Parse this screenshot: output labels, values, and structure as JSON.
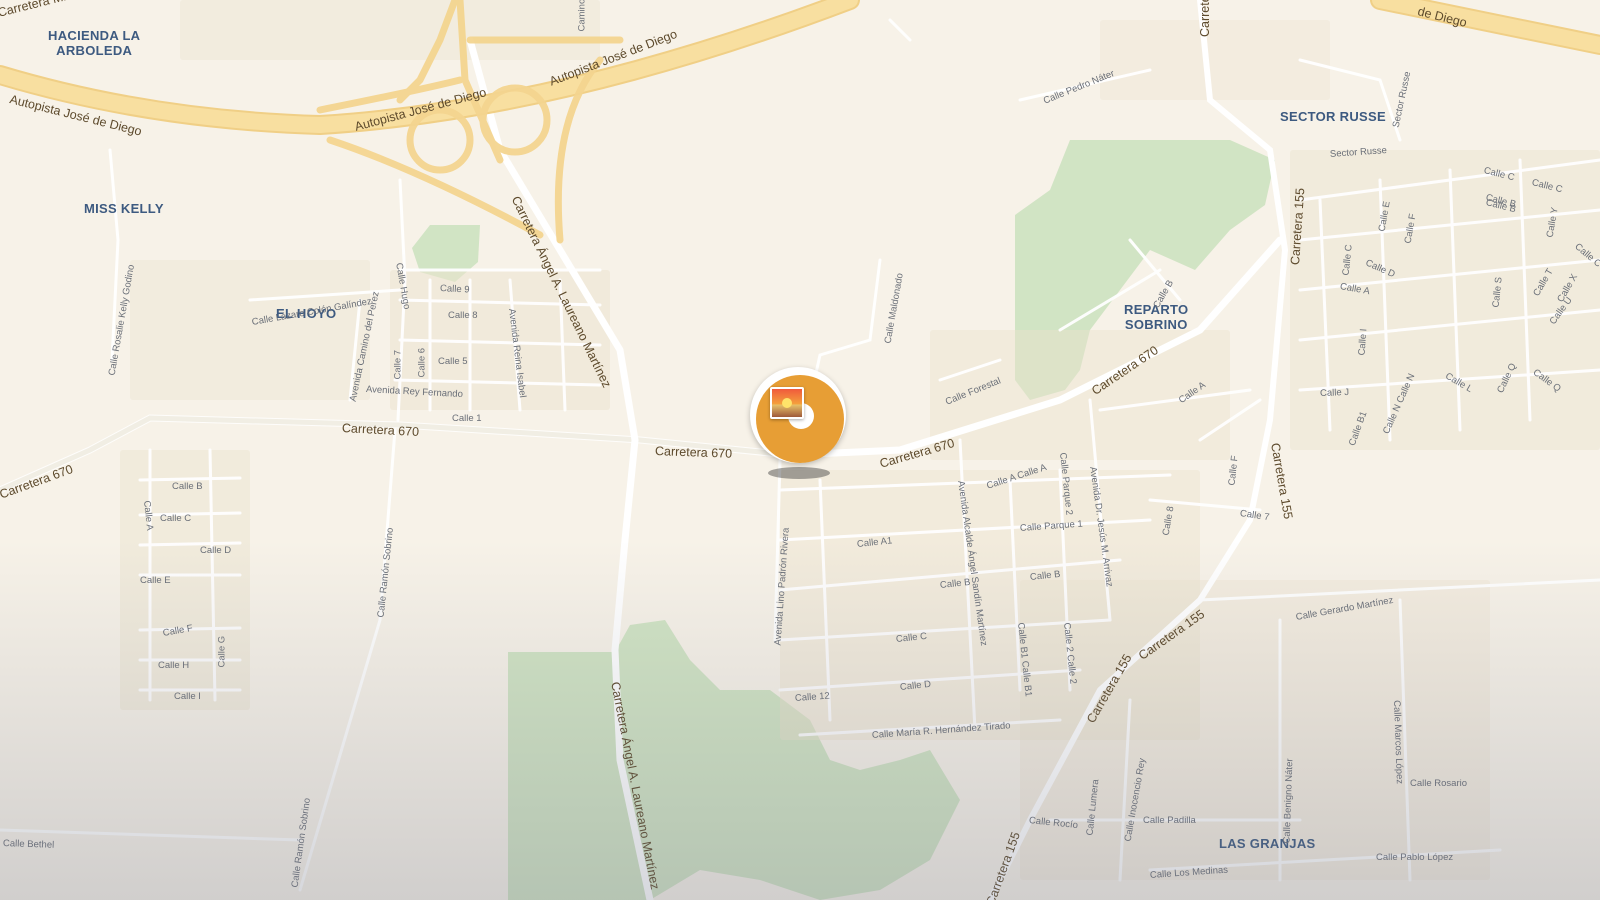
{
  "map": {
    "colors": {
      "background": "#f7f2e8",
      "highway": "#f8dfa0",
      "highway_casing": "#f0cf86",
      "main_road": "#ffffff",
      "street": "#ffffff",
      "park": "#cfe3c2",
      "building": "#efe7d6",
      "area_label": "#3d5a80"
    },
    "areas": {
      "hacienda": "HACIENDA LA\nARBOLEDA",
      "miss_kelly": "MISS KELLY",
      "el_hoyo": "EL HOYO",
      "sector_russe": "SECTOR RUSSE",
      "reparto_sobrino": "REPARTO\nSOBRINO",
      "las_granjas": "LAS GRANJAS"
    },
    "roads": {
      "carretera_militar": "Carretera Militar",
      "autopista_a": "Autopista José de Diego",
      "autopista_b": "Autopista José de Diego",
      "autopista_c": "Autopista José de Diego",
      "de_diego_end": "de Diego",
      "laureano_north": "Carretera Ángel A. Laureano Martínez",
      "laureano_south": "Carretera Ángel A. Laureano Martínez",
      "c670_west": "Carretera 670",
      "c670_mid": "Carretera 670",
      "c670_center": "Carretera 670",
      "c670_east": "Carretera 670",
      "c670_ne": "Carretera 670",
      "c155_north": "Carretera 155",
      "c155_mid": "Carretera 155",
      "c155_se1": "Carretera 155",
      "c155_se2": "Carretera 155",
      "c155_south": "Carretera 155",
      "carr_top": "Carretera"
    },
    "streets": {
      "camino": "Camino",
      "pedro_nater": "Calle Pedro Náter",
      "sector_russe": "Sector Russe",
      "sector_vert": "Sector Russe",
      "rosalie": "Calle Rosalie Kelly Godino",
      "lazaro": "Calle Lázaro Colón Galíndez",
      "calle_9": "Calle 9",
      "calle_8": "Calle 8",
      "calle_5": "Calle 5",
      "calle_7": "Calle 7",
      "calle_6": "Calle 6",
      "calle_1": "Calle 1",
      "hugo": "Calle Hugo",
      "camino_perez": "Avenida Camino del Perez",
      "rey_fernando": "Avenida Rey Fernando",
      "reina_isabel": "Avenida Reina Isabel",
      "maldonado": "Calle Maldonado",
      "forestal": "Calle Forestal",
      "calle_b_rep": "Calle B",
      "calle_a_rep": "Calle A",
      "calle_a_a": "Calle A  Calle A",
      "parque2": "Calle Parque 2",
      "parque1": "Calle Parque 1",
      "arrivaz": "Avenida Dr. Jesús M. Arrivaz",
      "sandin": "Avenida Alcalde Ángel Sandín Martínez",
      "calle_a1": "Calle A1",
      "lino": "Avenida Lino Padrón Rivera",
      "calle_b_s": "Calle B",
      "calle_b_s2": "Calle B",
      "calle_c_s": "Calle C",
      "calle_d_s": "Calle D",
      "calle_12": "Calle 12",
      "hernandez": "Calle María R. Hernández Tirado",
      "b1": "Calle B1 Calle B1",
      "calle_2": "Calle 2  Calle 2",
      "calle_8e": "Calle 8",
      "calle_7e": "Calle 7",
      "calle_f_e": "Calle F",
      "calle_j": "Calle J",
      "calle_l": "Calle L",
      "calle_q1": "Calle Q",
      "calle_q2": "Calle Q",
      "calle_n": "Calle N  Calle N",
      "calle_b1e": "Calle B1",
      "calle_i_e": "Calle I",
      "calle_a_e": "Calle A",
      "calle_d_e": "Calle D",
      "calle_c_e": "Calle C",
      "calle_b_e": "Calle B",
      "calle_cc": "Calle C",
      "calle_e_e": "Calle E",
      "calle_f_e2": "Calle F",
      "calle_y": "Calle Y",
      "calle_s": "Calle S",
      "calle_t": "Calle T",
      "calle_x": "Calle X",
      "calle_u": "Calle U",
      "calle_c_top": "Calle C",
      "calle_b_top": "Calle B",
      "calle_c_top2": "Calle C",
      "gerardo": "Calle Gerardo Martínez",
      "calle_b_w": "Calle B",
      "calle_a_w": "Calle A",
      "calle_c_w": "Calle C",
      "calle_d_w": "Calle D",
      "calle_e_w": "Calle E",
      "calle_f_w": "Calle F",
      "calle_g_w": "Calle G",
      "calle_h_w": "Calle H",
      "calle_i_w": "Calle I",
      "ramon_1": "Calle Ramón Sobrino",
      "ramon_2": "Calle Ramón Sobrino",
      "bethel": "Calle Bethel",
      "rocio": "Calle Rocío",
      "lumera": "Calle Lumera",
      "inocencio": "Calle Inocencio Rey",
      "padilla": "Calle Padilla",
      "benigno": "Calle Benigno Náter",
      "marcos": "Calle Marcos López",
      "rosario": "Calle Rosario",
      "pablo": "Calle Pablo López",
      "medinas": "Calle Los Medinas"
    },
    "marker": {
      "icon": "sunset-photo-icon",
      "color": "#e79e35"
    }
  }
}
